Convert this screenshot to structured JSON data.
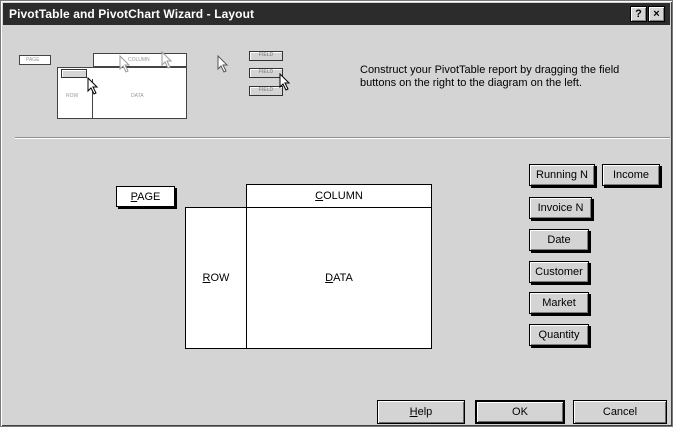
{
  "window": {
    "title": "PivotTable and PivotChart Wizard - Layout",
    "help_glyph": "?",
    "close_glyph": "×"
  },
  "illustration": {
    "page": "PAGE",
    "column": "COLUMN",
    "row": "ROW",
    "data": "DATA",
    "buttons": [
      "FIELD",
      "FIELD",
      "FIELD"
    ]
  },
  "instruction": "Construct your PivotTable report by dragging the field buttons on the right to the diagram on the left.",
  "diagram": {
    "page": {
      "accel": "P",
      "rest": "AGE"
    },
    "column": {
      "accel": "C",
      "rest": "OLUMN"
    },
    "row": {
      "accel": "R",
      "rest": "OW"
    },
    "data": {
      "accel": "D",
      "rest": "ATA"
    }
  },
  "fields": [
    "Running N",
    "Income",
    "Invoice N",
    "Date",
    "Customer",
    "Market",
    "Quantity"
  ],
  "buttons": {
    "help": {
      "accel": "H",
      "rest": "elp"
    },
    "ok": "OK",
    "cancel": "Cancel"
  }
}
